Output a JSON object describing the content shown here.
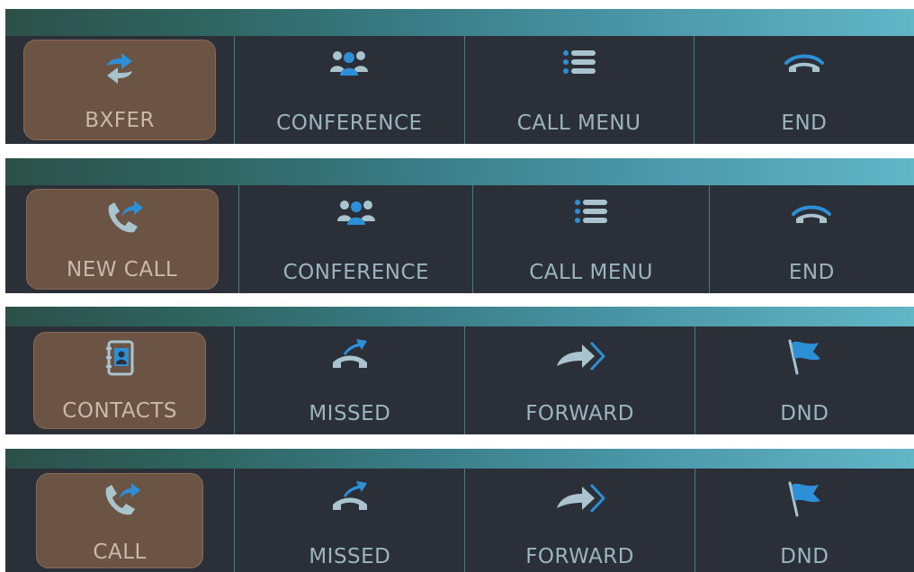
{
  "bars": [
    {
      "buttons": [
        {
          "label": "BXFER",
          "icon": "transfer-icon",
          "active": true
        },
        {
          "label": "CONFERENCE",
          "icon": "conference-icon"
        },
        {
          "label": "CALL MENU",
          "icon": "menu-list-icon"
        },
        {
          "label": "END",
          "icon": "hangup-icon"
        }
      ]
    },
    {
      "buttons": [
        {
          "label": "NEW CALL",
          "icon": "new-call-icon",
          "active": true
        },
        {
          "label": "CONFERENCE",
          "icon": "conference-icon"
        },
        {
          "label": "CALL MENU",
          "icon": "menu-list-icon"
        },
        {
          "label": "END",
          "icon": "hangup-icon"
        }
      ]
    },
    {
      "buttons": [
        {
          "label": "CONTACTS",
          "icon": "contacts-book-icon",
          "active": true
        },
        {
          "label": "MISSED",
          "icon": "missed-call-icon"
        },
        {
          "label": "FORWARD",
          "icon": "forward-arrow-icon"
        },
        {
          "label": "DND",
          "icon": "dnd-flag-icon"
        }
      ]
    },
    {
      "buttons": [
        {
          "label": "CALL",
          "icon": "new-call-icon",
          "active": true
        },
        {
          "label": "MISSED",
          "icon": "missed-call-icon"
        },
        {
          "label": "FORWARD",
          "icon": "forward-arrow-icon"
        },
        {
          "label": "DND",
          "icon": "dnd-flag-icon"
        }
      ]
    }
  ],
  "colors": {
    "bar_bg": "#2b2f38",
    "active_bg": "#6b5444",
    "icon_blue": "#2d8fd6",
    "icon_light": "#a9c4cf",
    "label": "#9ab5bf"
  }
}
